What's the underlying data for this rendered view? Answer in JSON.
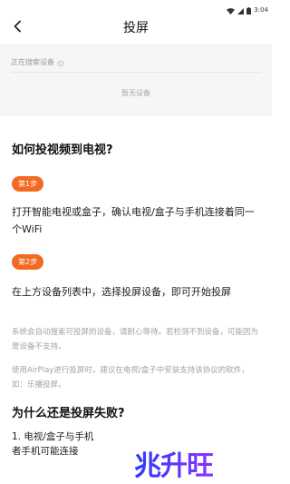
{
  "status_bar": {
    "time": "3:04"
  },
  "nav": {
    "title": "投屏",
    "back_icon": "chevron-left-icon"
  },
  "search": {
    "status": "正在搜索设备",
    "empty_text": "暂无设备"
  },
  "help": {
    "title": "如何投视频到电视?",
    "step1_badge": "第1步",
    "step1_text": "打开智能电视或盒子，确认电视/盒子与手机连接着同一个WiFi",
    "step2_badge": "第2步",
    "step2_text": "在上方设备列表中，选择投屏设备，即可开始投屏",
    "note1": "系统会自动搜索可投屏的设备，请耐心等待。若检测不到设备，可能因为是设备不支持。",
    "note2": "使用AirPlay进行投屏时，建议在电视/盒子中安装支持该协议的软件，如：乐播投屏。"
  },
  "faq": {
    "title": "为什么还是投屏失败?",
    "item1_line1": "1. 电视/盒子与手机",
    "item1_line2": "者手机可能连接"
  },
  "watermark": {
    "text": "兆升旺"
  },
  "colors": {
    "accent": "#f26a21",
    "watermark_start": "#2a3bff",
    "watermark_end": "#8b33ff"
  }
}
